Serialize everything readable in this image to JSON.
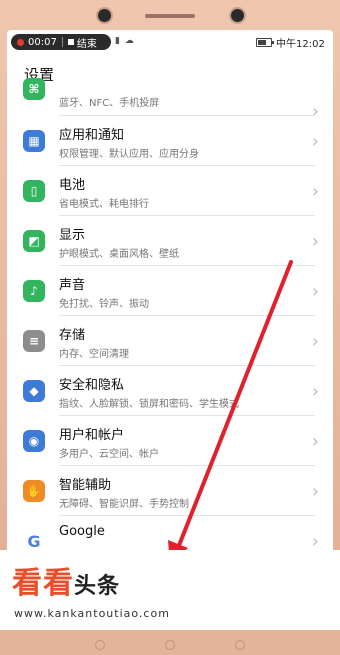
{
  "status_bar": {
    "rec_time": "00:07",
    "rec_action": "结束",
    "icons": "▮ ☁",
    "battery_level": 0.7,
    "clock": "中午12:02"
  },
  "app": {
    "title": "设置"
  },
  "settings": [
    {
      "title": "",
      "sub": "蓝牙、NFC、手机投屏",
      "icon": "bluetooth-icon",
      "icon_glyph": "⌘",
      "color": "green"
    },
    {
      "title": "应用和通知",
      "sub": "权限管理、默认应用、应用分身",
      "icon": "apps-icon",
      "icon_glyph": "▦",
      "color": "blue"
    },
    {
      "title": "电池",
      "sub": "省电模式、耗电排行",
      "icon": "battery-icon",
      "icon_glyph": "▯",
      "color": "green"
    },
    {
      "title": "显示",
      "sub": "护眼模式、桌面风格、壁纸",
      "icon": "display-icon",
      "icon_glyph": "◩",
      "color": "green"
    },
    {
      "title": "声音",
      "sub": "免打扰、铃声、振动",
      "icon": "sound-icon",
      "icon_glyph": "♪",
      "color": "green"
    },
    {
      "title": "存储",
      "sub": "内存、空间清理",
      "icon": "storage-icon",
      "icon_glyph": "≡",
      "color": "gray"
    },
    {
      "title": "安全和隐私",
      "sub": "指纹、人脸解锁、锁屏和密码、学生模式",
      "icon": "shield-icon",
      "icon_glyph": "◆",
      "color": "blue"
    },
    {
      "title": "用户和帐户",
      "sub": "多用户、云空间、帐户",
      "icon": "user-icon",
      "icon_glyph": "◉",
      "color": "blue"
    },
    {
      "title": "智能辅助",
      "sub": "无障碍、智能识屏、手势控制",
      "icon": "hand-icon",
      "icon_glyph": "✋",
      "color": "orange"
    },
    {
      "title": "Google",
      "sub": "",
      "icon": "google-icon",
      "icon_glyph": "G",
      "color": "google"
    }
  ],
  "watermark": {
    "logo_main": "看看",
    "logo_tail": "头条",
    "url": "www.kankantoutiao.com"
  }
}
